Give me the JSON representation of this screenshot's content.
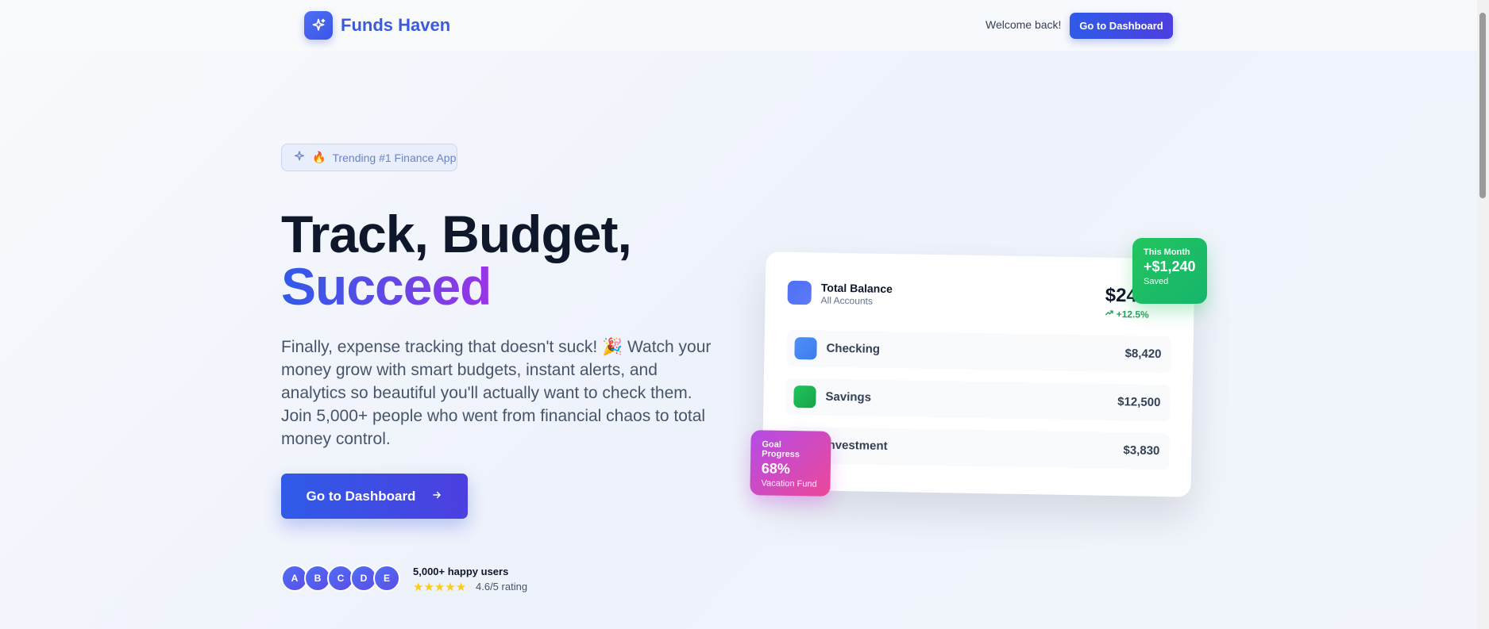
{
  "nav": {
    "brand": "Funds Haven",
    "welcome": "Welcome back!",
    "dashboard_button": "Go to Dashboard"
  },
  "hero": {
    "badge": "Trending #1 Finance App",
    "badge_emoji": "🔥",
    "title_line1": "Track, Budget,",
    "title_line2": "Succeed",
    "description": "Finally, expense tracking that doesn't suck! 🎉 Watch your money grow with smart budgets, instant alerts, and analytics so beautiful you'll actually want to check them. Join 5,000+ people who went from financial chaos to total money control.",
    "cta": "Go to Dashboard",
    "avatars": [
      "A",
      "B",
      "C",
      "D",
      "E"
    ],
    "users_count": "5,000+ happy users",
    "rating": "4.6/5 rating",
    "stars": "★★★★★"
  },
  "card": {
    "total_title": "Total Balance",
    "total_sub": "All Accounts",
    "total_amount": "$24",
    "total_change": "+12.5%",
    "accounts": [
      {
        "name": "Checking",
        "value": "$8,420",
        "color": "#4f8ff7"
      },
      {
        "name": "Savings",
        "value": "$12,500",
        "color": "#22c55e"
      },
      {
        "name": "Investment",
        "value": "$3,830",
        "color": "#b44ce6"
      }
    ]
  },
  "tags": {
    "month_label": "This Month",
    "month_value": "+$1,240",
    "month_sub": "Saved",
    "goal_label": "Goal Progress",
    "goal_value": "68%",
    "goal_sub": "Vacation Fund"
  },
  "colors": {
    "accent": "#2f5be8",
    "gradient_end": "#9b34e6",
    "green": "#22c55e",
    "pink": "#ec4899"
  }
}
